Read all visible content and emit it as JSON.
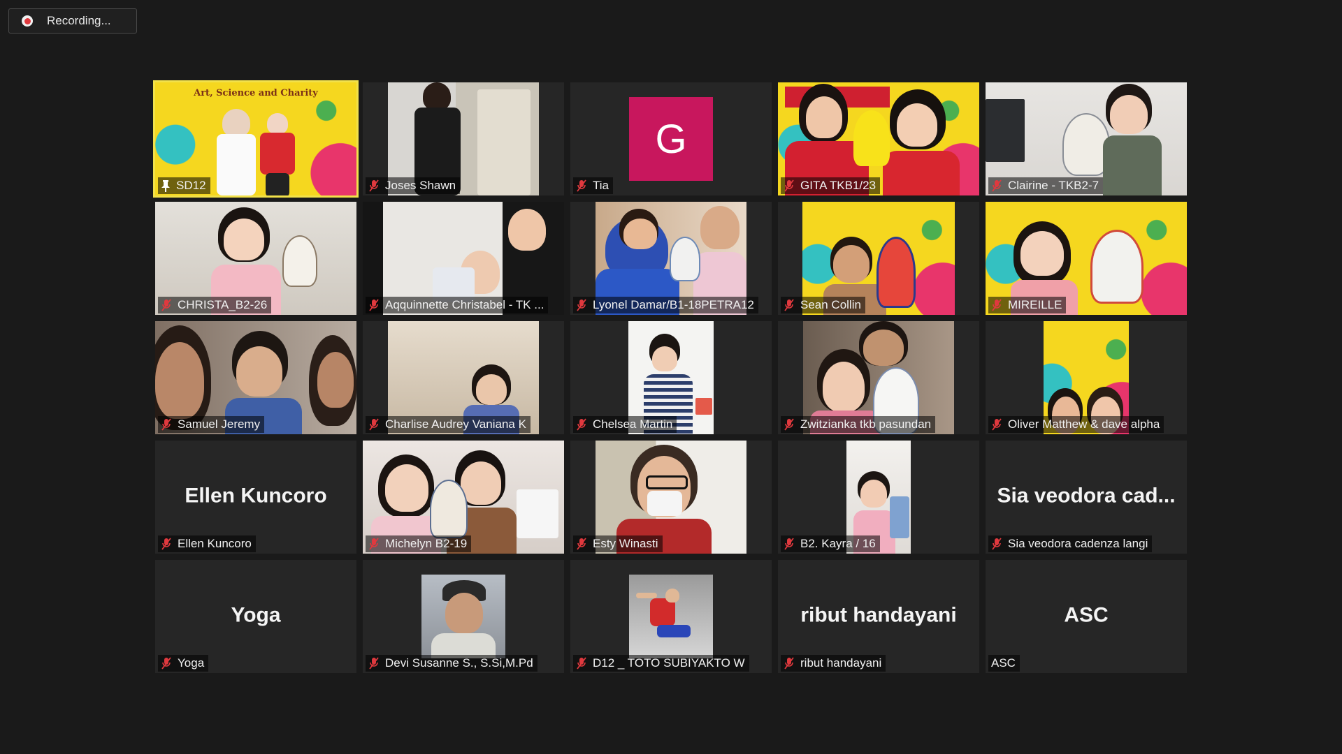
{
  "recording": {
    "label": "Recording..."
  },
  "poster_title": "Art, Science and Charity",
  "colors": {
    "background": "#1a1a1a",
    "tile": "#262626",
    "active_speaker_border": "#f2e14a",
    "muted_icon": "#e0393e",
    "avatar_bg": "#c8175d"
  },
  "participants": [
    {
      "name": "SD12",
      "icon": "pin-icon",
      "kind": "poster",
      "active": true
    },
    {
      "name": "Joses Shawn",
      "icon": "mic-muted-icon",
      "kind": "video"
    },
    {
      "name": "Tia",
      "icon": "mic-muted-icon",
      "kind": "avatar",
      "initial": "G"
    },
    {
      "name": "GITA TKB1/23",
      "icon": "mic-muted-icon",
      "kind": "poster"
    },
    {
      "name": "Clairine - TKB2-7",
      "icon": "mic-muted-icon",
      "kind": "video"
    },
    {
      "name": "CHRISTA_B2-26",
      "icon": "mic-muted-icon",
      "kind": "video"
    },
    {
      "name": "Aqquinnette Christabel - TK ...",
      "icon": "mic-muted-icon",
      "kind": "video"
    },
    {
      "name": "Lyonel Damar/B1-18PETRA12",
      "icon": "mic-muted-icon",
      "kind": "video"
    },
    {
      "name": "Sean Collin",
      "icon": "mic-muted-icon",
      "kind": "poster"
    },
    {
      "name": "MIREILLE",
      "icon": "mic-muted-icon",
      "kind": "poster"
    },
    {
      "name": "Samuel Jeremy",
      "icon": "mic-muted-icon",
      "kind": "video"
    },
    {
      "name": "Charlise Audrey Vaniana K",
      "icon": "mic-muted-icon",
      "kind": "video"
    },
    {
      "name": "Chelsea Martin",
      "icon": "mic-muted-icon",
      "kind": "video"
    },
    {
      "name": "Zwitzianka tkb pasundan",
      "icon": "mic-muted-icon",
      "kind": "video"
    },
    {
      "name": "Oliver Matthew & dave alpha",
      "icon": "mic-muted-icon",
      "kind": "poster"
    },
    {
      "name": "Ellen Kuncoro",
      "icon": "mic-muted-icon",
      "kind": "name",
      "display": "Ellen Kuncoro"
    },
    {
      "name": "Michelyn B2-19",
      "icon": "mic-muted-icon",
      "kind": "video"
    },
    {
      "name": "Esty Winasti",
      "icon": "mic-muted-icon",
      "kind": "video"
    },
    {
      "name": "B2. Kayra / 16",
      "icon": "mic-muted-icon",
      "kind": "video"
    },
    {
      "name": "Sia veodora cadenza langi",
      "icon": "mic-muted-icon",
      "kind": "name",
      "display": "Sia  veodora  cad..."
    },
    {
      "name": "Yoga",
      "icon": "mic-muted-icon",
      "kind": "name",
      "display": "Yoga"
    },
    {
      "name": "Devi Susanne S., S.Si,M.Pd",
      "icon": "mic-muted-icon",
      "kind": "photo"
    },
    {
      "name": "D12 _ TOTO SUBIYAKTO W",
      "icon": "mic-muted-icon",
      "kind": "photo"
    },
    {
      "name": "ribut handayani",
      "icon": "mic-muted-icon",
      "kind": "name",
      "display": "ribut handayani"
    },
    {
      "name": "ASC",
      "icon": "none",
      "kind": "name",
      "display": "ASC"
    }
  ]
}
